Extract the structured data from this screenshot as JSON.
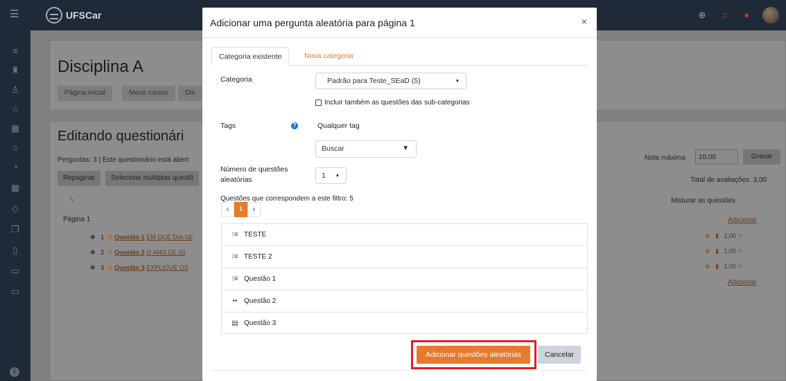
{
  "app": {
    "logo_text": "UFSCar"
  },
  "navbar": {
    "icons": [
      "globe-icon",
      "bell-icon",
      "chat-icon",
      "user-avatar"
    ]
  },
  "sidebar": {
    "icons": [
      "list-icon",
      "users-icon",
      "badge-icon",
      "star-icon",
      "book-icon",
      "home-icon",
      "dashboard-icon",
      "calendar-icon",
      "graduation-icon",
      "files-icon",
      "clipboard-icon",
      "folder-icon",
      "folder-icon"
    ]
  },
  "page": {
    "title": "Disciplina A",
    "breadcrumb": [
      "Página inicial",
      "Meus cursos",
      "Dis"
    ],
    "section_title": "Editando questionári",
    "summary": "Perguntas: 3 | Este questionário está abert",
    "repaginate_label": "Repaginar",
    "select_multiple_label": "Selecione multiplas questõ",
    "max_grade_label": "Nota máxima",
    "max_grade_value": "10,00",
    "save_label": "Gravar",
    "total_label": "Total de avaliações: 3,00",
    "shuffle_label": "Misturar as questões",
    "add_label": "Adicionar",
    "page_label": "Página 1",
    "questions": [
      {
        "num": "1",
        "name": "Questão 1",
        "text": "EM QUE DIA SE",
        "grade": "1,00"
      },
      {
        "num": "2",
        "name": "Questão 2",
        "text": "O ANO DE 20",
        "grade": "1,00"
      },
      {
        "num": "3",
        "name": "Questão 3",
        "text": "EXPLIQUE OS",
        "grade": "1,00"
      }
    ]
  },
  "modal": {
    "title": "Adicionar uma pergunta aleatória para página 1",
    "close_glyph": "×",
    "tabs": [
      {
        "label": "Categoria existente"
      },
      {
        "label": "Nova categoria"
      }
    ],
    "category_label": "Categoria",
    "category_value": "Padrão para Teste_SEaD (5)",
    "subcategories_label": "Incluir também as questões das sub-categorias",
    "tags_label": "Tags",
    "tags_value": "Qualquer tag",
    "search_value": "Buscar",
    "num_questions_label_1": "Número de questões",
    "num_questions_label_2": "aleatórias",
    "num_questions_value": "1",
    "filter_text": "Questões que correspondem a este filtro: 5",
    "pager": {
      "prev": "‹",
      "current": "1",
      "next": "›"
    },
    "question_list": [
      {
        "icon": "multichoice-icon",
        "glyph": "⁝≡",
        "label": "TESTE"
      },
      {
        "icon": "multichoice-icon",
        "glyph": "⁝≡",
        "label": "TESTE 2"
      },
      {
        "icon": "multichoice-icon",
        "glyph": "⁝≡",
        "label": "Questão 1"
      },
      {
        "icon": "truefalse-icon",
        "glyph": "••",
        "label": "Questão 2"
      },
      {
        "icon": "essay-icon",
        "glyph": "▤",
        "label": "Questão 3"
      }
    ],
    "add_button": "Adicionar questões aleatórias",
    "cancel_button": "Cancelar"
  },
  "colors": {
    "accent": "#e8792d",
    "highlight": "#e11d24",
    "navbar": "#1e2a38",
    "help": "#1177d1"
  }
}
